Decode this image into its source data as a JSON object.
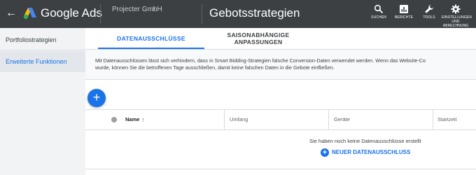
{
  "header": {
    "back_icon": "arrow-left-icon",
    "brand": "Google Ads",
    "account": "Projecter GmbH",
    "page_title": "Gebotsstrategien",
    "tools": [
      {
        "icon": "search-icon",
        "label": "SUCHEN"
      },
      {
        "icon": "reports-icon",
        "label": "BERICHTE"
      },
      {
        "icon": "wrench-icon",
        "label": "TOOLS"
      },
      {
        "icon": "gear-icon",
        "label": "EINSTELLUNGEN UND ABRECHNUNG"
      }
    ]
  },
  "sidebar": {
    "items": [
      {
        "label": "Portfoliostrategien",
        "active": false
      },
      {
        "label": "Erweiterte Funktionen",
        "active": true
      }
    ]
  },
  "tabs": [
    {
      "label": "DATENAUSSCHLÜSSE",
      "active": true
    },
    {
      "label": "SAISONABHÄNGIGE ANPASSUNGEN",
      "active": false
    }
  ],
  "description": {
    "line1": "Mit Datenausschlüssen lässt sich verhindern, dass in Smart Bidding-Strategien falsche Conversion-Daten verwendet werden. Wenn das Website-Co",
    "line2": "wurde, können Sie die betroffenen Tage ausschließen, damit keine falschen Daten in die Gebote einfließen."
  },
  "table": {
    "columns": [
      "Name",
      "Umfang",
      "Geräte",
      "Startzeit"
    ],
    "empty_message": "Sie haben noch keine Datenausschlüsse erstellt",
    "new_button": "NEUER DATENAUSSCHLUSS"
  },
  "colors": {
    "accent": "#1a73e8",
    "topbar": "#3c4043"
  }
}
